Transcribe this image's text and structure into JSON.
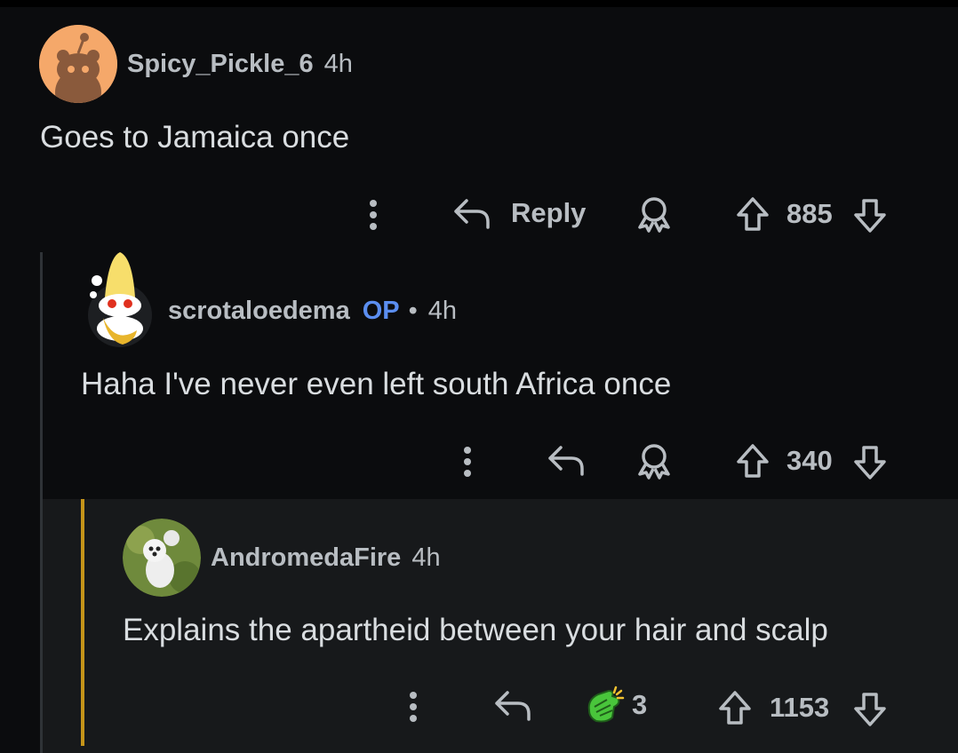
{
  "comments": [
    {
      "username": "Spicy_Pickle_6",
      "time": "4h",
      "body": "Goes to Jamaica once",
      "reply_label": "Reply",
      "score": "885"
    },
    {
      "username": "scrotaloedema",
      "op_badge": "OP",
      "separator": "•",
      "time": "4h",
      "body": "Haha I've never even left south Africa once",
      "score": "340"
    },
    {
      "username": "AndromedaFire",
      "time": "4h",
      "body": "Explains the apartheid between your hair and scalp",
      "award_count": "3",
      "score": "1153"
    }
  ],
  "colors": {
    "background": "#0b0c0e",
    "highlight": "#17191b",
    "op": "#5b8ef0",
    "gold_thread": "#c59419",
    "muted_text": "#b8bdc2"
  },
  "icons": [
    "more-vertical-icon",
    "reply-icon",
    "award-icon",
    "upvote-icon",
    "downvote-icon",
    "clap-award-icon"
  ]
}
